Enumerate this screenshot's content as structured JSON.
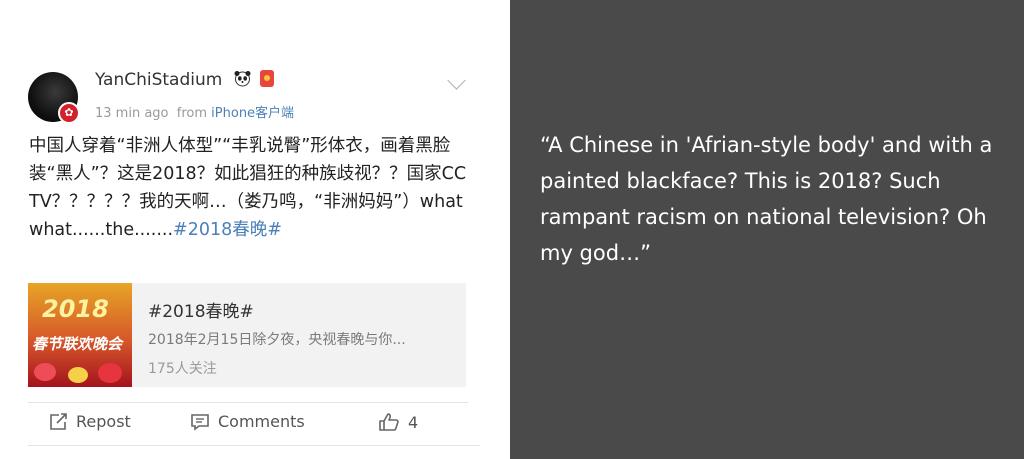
{
  "post": {
    "username": "YanChiStadium",
    "time": "13 min ago",
    "from_label": "from",
    "source": "iPhone客户端",
    "text": "中国人穿着“非洲人体型”“丰乳说臀”形体衣，画着黑脸装“黑人”？这是2018？如此猖狂的种族歧视？？国家CCTV？？？？？我的天啊…（娄乃鸣，“非洲妈妈”）what what......the.......",
    "hashtag": "#2018春晚#"
  },
  "card": {
    "title": "#2018春晚#",
    "description": "2018年2月15日除夕夜，央视春晚与你...",
    "followers": "175人关注",
    "thumb_year": "2018",
    "thumb_title": "春节联欢晚会"
  },
  "actions": {
    "repost": "Repost",
    "comments": "Comments",
    "likes": "4"
  },
  "translation": "“A Chinese in 'Afrian-style body' and with a painted blackface? This is 2018?  Such rampant racism on national television? Oh my god…”",
  "colors": {
    "link": "#4c80b8",
    "right_panel_bg": "#4a4a4a"
  }
}
